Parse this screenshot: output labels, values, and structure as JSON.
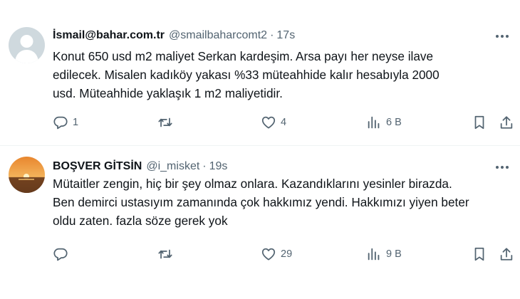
{
  "tweets": [
    {
      "display_name": "İsmail@bahar.com.tr",
      "handle": "@smailbaharcomt2",
      "separator": "·",
      "time": "17s",
      "text": "Konut 650 usd m2 maliyet Serkan kardeşim. Arsa payı her neyse ilave\nedilecek. Misalen kadıköy yakası %33 müteahhide kalır hesabıyla   2000\nusd. Müteahhide yaklaşık 1 m2 maliyetidir.",
      "replies": "1",
      "retweets": "",
      "likes": "4",
      "views": "6 B",
      "avatar_icon": "default-user-avatar"
    },
    {
      "display_name": "BOŞVER GİTSİN",
      "handle": "@i_misket",
      "separator": "·",
      "time": "19s",
      "text": "Mütaitler zengin, hiç bir şey olmaz onlara. Kazandıklarını yesinler birazda.\nBen demirci ustasıyım zamanında çok hakkımız yendi. Hakkımızı yiyen beter\noldu zaten. fazla söze gerek yok",
      "replies": "",
      "retweets": "",
      "likes": "29",
      "views": "9 B",
      "avatar_icon": "sunset-sea-photo-avatar"
    }
  ],
  "colors": {
    "text_primary": "#0f1419",
    "text_secondary": "#536471",
    "divider": "#eff3f4",
    "default_avatar_bg": "#cfd9de"
  },
  "icons": {
    "reply": "speech-bubble-icon",
    "retweet": "retweet-arrows-icon",
    "like": "heart-icon",
    "views": "bar-chart-icon",
    "bookmark": "bookmark-icon",
    "share": "share-upload-icon",
    "more": "three-dots-icon"
  }
}
